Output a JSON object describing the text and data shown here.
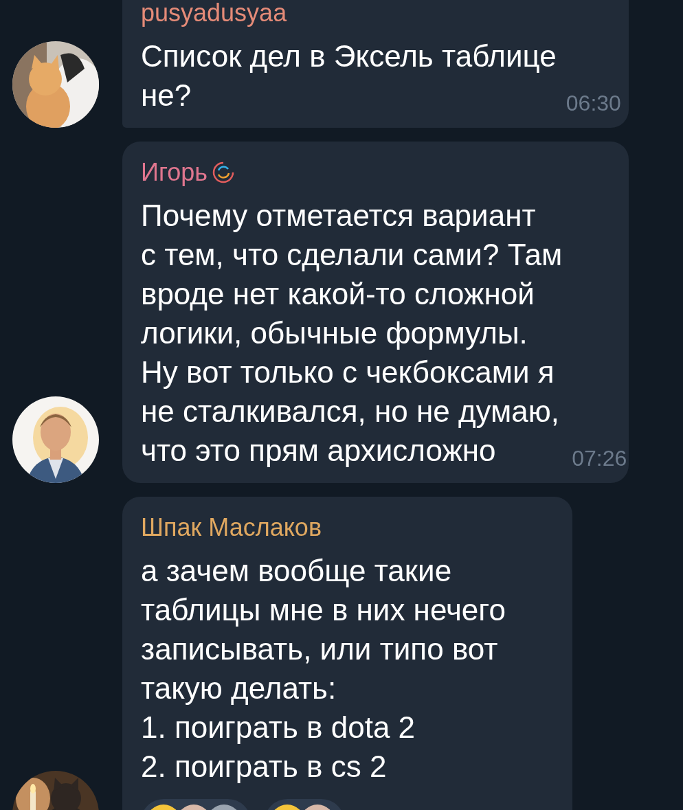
{
  "messages": [
    {
      "author": "pusyadusyaa",
      "color": "#e58b78",
      "badge": false,
      "avatar": {
        "kind": "picture"
      },
      "text": "Список дел в Эксель таблице\nне?",
      "time": "06:30"
    },
    {
      "author": "Игорь",
      "color": "#e0768f",
      "badge": true,
      "avatar": {
        "kind": "picture"
      },
      "text": "Почему отметается вариант\nс тем, что сделали сами? Там\nвроде нет какой-то сложной\nлогики, обычные формулы.\nНу вот только с чекбоксами я\nне сталкивался, но не думаю,\nчто это прям архисложно",
      "time": "07:26"
    },
    {
      "author": "Шпак Маслаков",
      "color": "#e0a860",
      "badge": false,
      "avatar": {
        "kind": "picture"
      },
      "text": "а зачем вообще такие\nтаблицы мне в них нечего\nзаписывать, или типо вот\nтакую делать:\n1. поиграть в dota 2\n2. поиграть в cs 2",
      "reactions": [
        {
          "kind": "reaction"
        },
        {
          "kind": "reaction"
        }
      ]
    }
  ]
}
